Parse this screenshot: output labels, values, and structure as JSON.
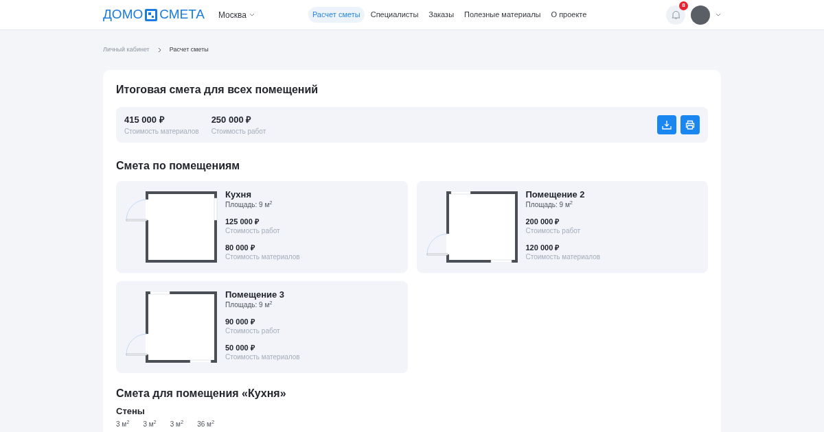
{
  "header": {
    "logo": [
      "ДОМО",
      "СМЕТА"
    ],
    "city": "Москва",
    "nav": [
      {
        "label": "Расчет сметы",
        "selected": true
      },
      {
        "label": "Специалисты",
        "selected": false
      },
      {
        "label": "Заказы",
        "selected": false
      },
      {
        "label": "Полезные материалы",
        "selected": false
      },
      {
        "label": "О проекте",
        "selected": false
      }
    ],
    "notifications": "8"
  },
  "breadcrumbs": [
    "Личный кабинет",
    "Расчет сметы"
  ],
  "total": {
    "title": "Итоговая смета для всех помещений",
    "items": [
      {
        "value": "415 000 ₽",
        "label": "Стоимость материалов"
      },
      {
        "value": "250 000 ₽",
        "label": "Стоимость работ"
      }
    ]
  },
  "rooms_title": "Смета по помещениям",
  "rooms": [
    {
      "name": "Кухня",
      "area": "Площадь: 9 м$^{2}$",
      "kind": "upper",
      "costs": [
        {
          "value": "125 000 ₽",
          "label": "Стоимость работ"
        },
        {
          "value": "80 000 ₽",
          "label": "Стоимость материалов"
        }
      ]
    },
    {
      "name": "Помещение 2",
      "area": "Площадь: 9 м$^{2}$",
      "kind": "lower",
      "costs": [
        {
          "value": "200 000 ₽",
          "label": "Стоимость работ"
        },
        {
          "value": "120 000 ₽",
          "label": "Стоимость материалов"
        }
      ]
    },
    {
      "name": "Помещение 3",
      "area": "Площадь: 9 м$^{2}$",
      "kind": "lower",
      "costs": [
        {
          "value": "90 000 ₽",
          "label": "Стоимость работ"
        },
        {
          "value": "50 000 ₽",
          "label": "Стоимость материалов"
        }
      ]
    }
  ],
  "room_detail": {
    "title": "Смета для помещения «Кухня»",
    "section": "Стены",
    "values": [
      "3 м$^{2}$",
      "3 м$^{2}$",
      "3 м$^{2}$",
      "36 м$^{2}$"
    ]
  }
}
